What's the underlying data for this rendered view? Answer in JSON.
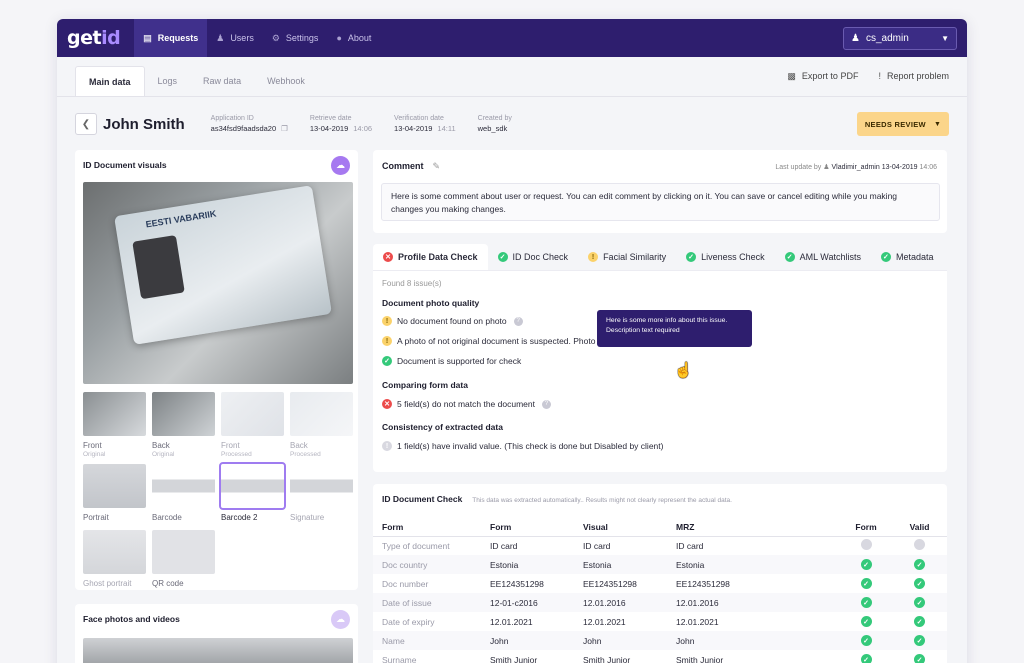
{
  "app": {
    "logo_main": "get",
    "logo_accent": "id"
  },
  "nav": {
    "items": [
      {
        "label": "Requests",
        "icon": "list-icon",
        "active": true
      },
      {
        "label": "Users",
        "icon": "users-icon",
        "active": false
      },
      {
        "label": "Settings",
        "icon": "gear-icon",
        "active": false
      },
      {
        "label": "About",
        "icon": "info-icon",
        "active": false
      }
    ],
    "user": "cs_admin"
  },
  "tabs": [
    "Main data",
    "Logs",
    "Raw data",
    "Webhook"
  ],
  "actions": {
    "export": "Export to PDF",
    "report": "Report problem"
  },
  "person": {
    "name": "John Smith",
    "meta": [
      {
        "label": "Application ID",
        "value": "as34fsd9faadsda20",
        "time": ""
      },
      {
        "label": "Retrieve date",
        "value": "13-04-2019",
        "time": "14:06"
      },
      {
        "label": "Verification date",
        "value": "13-04-2019",
        "time": "14:11"
      },
      {
        "label": "Created by",
        "value": "web_sdk",
        "time": ""
      }
    ],
    "status": "NEEDS REVIEW"
  },
  "visuals": {
    "title": "ID Document visuals",
    "card_header": "EESTI VABARIIK",
    "thumbs_row1": [
      {
        "label": "Front",
        "sub": "Original"
      },
      {
        "label": "Back",
        "sub": "Original"
      },
      {
        "label": "Front",
        "sub": "Processed"
      },
      {
        "label": "Back",
        "sub": "Processed"
      }
    ],
    "thumbs_row2": [
      {
        "label": "Portrait",
        "sub": ""
      },
      {
        "label": "Barcode",
        "sub": ""
      },
      {
        "label": "Barcode 2",
        "sub": ""
      },
      {
        "label": "Signature",
        "sub": ""
      }
    ],
    "thumbs_row3": [
      {
        "label": "Ghost portrait",
        "sub": ""
      },
      {
        "label": "QR code",
        "sub": ""
      }
    ]
  },
  "face": {
    "title": "Face photos and videos"
  },
  "comment": {
    "title": "Comment",
    "last_update_label": "Last update by",
    "last_update_user": "Vladimir_admin",
    "last_update_date": "13-04-2019",
    "last_update_time": "14:06",
    "text": "Here is some comment about user or request. You can edit comment by clicking on it. You can save or cancel editing while you making changes you making changes."
  },
  "checks": {
    "tabs": [
      {
        "label": "Profile Data Check",
        "status": "red"
      },
      {
        "label": "ID Doc Check",
        "status": "green"
      },
      {
        "label": "Facial Similarity",
        "status": "yellow"
      },
      {
        "label": "Liveness Check",
        "status": "green"
      },
      {
        "label": "AML Watchlists",
        "status": "green"
      },
      {
        "label": "Metadata",
        "status": "green"
      }
    ],
    "found": "Found 8 issue(s)",
    "sections": [
      {
        "title": "Document photo quality",
        "issues": [
          {
            "text": "No document found on photo",
            "status": "yellow"
          },
          {
            "text": "A photo of not original document is suspected. Photo of the screen",
            "status": "yellow"
          },
          {
            "text": "Document is supported for check",
            "status": "green"
          }
        ]
      },
      {
        "title": "Comparing form data",
        "issues": [
          {
            "text": "5 field(s) do not match the document",
            "status": "red"
          }
        ]
      },
      {
        "title": "Consistency of extracted data",
        "issues": [
          {
            "text": "1 field(s) have invalid value. (This check is done but Disabled by client)",
            "status": "gray"
          }
        ]
      }
    ],
    "tooltip": "Here is some more info about this issue. Description text required"
  },
  "idtable": {
    "title": "ID Document Check",
    "subtitle": "This data was extracted automatically.. Results might not clearly represent the actual data.",
    "headers": [
      "Form",
      "Form",
      "Visual",
      "MRZ",
      "Form",
      "Valid"
    ],
    "rows": [
      {
        "field": "Type of document",
        "form": "ID card",
        "visual": "ID card",
        "mrz": "ID card",
        "f": "gray",
        "v": "gray"
      },
      {
        "field": "Doc country",
        "form": "Estonia",
        "visual": "Estonia",
        "mrz": "Estonia",
        "f": "green",
        "v": "green"
      },
      {
        "field": "Doc number",
        "form": "EE124351298",
        "visual": "EE124351298",
        "mrz": "EE124351298",
        "f": "green",
        "v": "green"
      },
      {
        "field": "Date of issue",
        "form": "12-01-c2016",
        "visual": "12.01.2016",
        "mrz": "12.01.2016",
        "f": "green",
        "v": "green"
      },
      {
        "field": "Date of expiry",
        "form": "12.01.2021",
        "visual": "12.01.2021",
        "mrz": "12.01.2021",
        "f": "green",
        "v": "green"
      },
      {
        "field": "Name",
        "form": "John",
        "visual": "John",
        "mrz": "John",
        "f": "green",
        "v": "green"
      },
      {
        "field": "Surname",
        "form": "Smith Junior",
        "visual": "Smith Junior",
        "mrz": "Smith Junior",
        "f": "green",
        "v": "green"
      }
    ]
  }
}
